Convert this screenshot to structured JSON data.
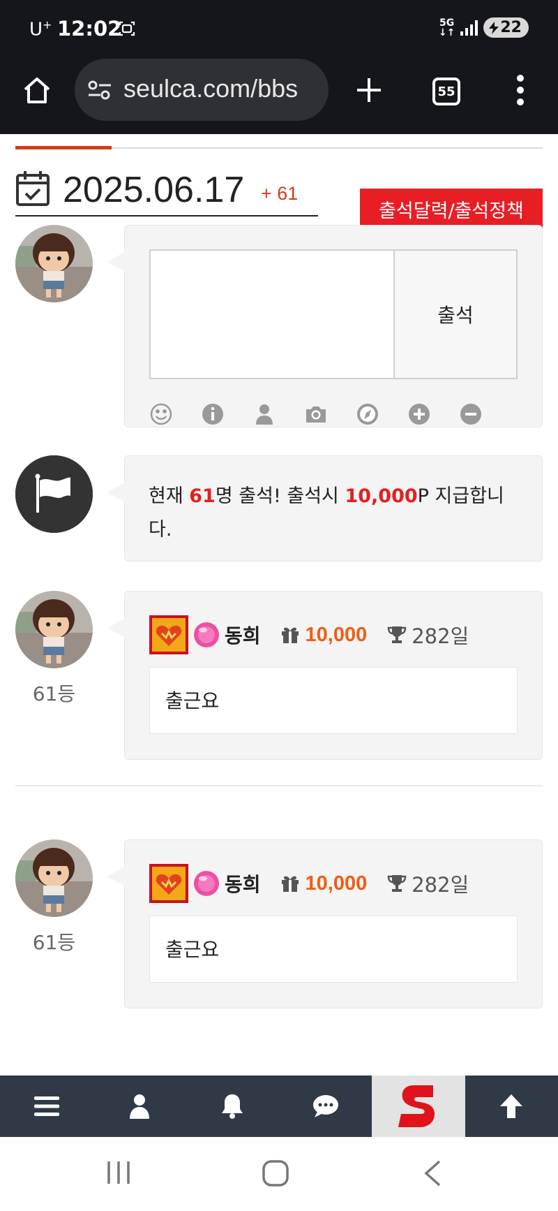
{
  "status_bar": {
    "carrier": "U",
    "carrier_sup": "+",
    "time": "12:02",
    "network": "5G",
    "battery": "22"
  },
  "browser": {
    "url": "seulca.com/bbs",
    "tab_count": "55"
  },
  "header": {
    "date": "2025.06.17",
    "count": "+ 61",
    "policy_button": "출석달력/출석정책"
  },
  "form": {
    "input_value": "",
    "submit_label": "출석",
    "tools": [
      "smile-icon",
      "info-icon",
      "user-icon",
      "camera-icon",
      "compass-icon",
      "plus-circle-icon",
      "minus-circle-icon"
    ]
  },
  "notice": {
    "prefix": "현재 ",
    "count": "61",
    "middle": "명 출석! 출석시 ",
    "points": "10,000",
    "suffix": "P 지급합니다."
  },
  "entries": [
    {
      "rank": "61등",
      "name": "동희",
      "points": "10,000",
      "days": "282일",
      "message": "출근요"
    },
    {
      "rank": "61등",
      "name": "동희",
      "points": "10,000",
      "days": "282일",
      "message": "출근요"
    }
  ],
  "bottom_nav": [
    "menu-icon",
    "user-icon",
    "bell-icon",
    "chat-icon",
    "site-logo",
    "arrow-up-icon"
  ],
  "colors": {
    "accent_red": "#e81e25",
    "points_orange": "#f35b12",
    "nav_bg": "#2f3a46",
    "dark_bar": "#15161b"
  }
}
